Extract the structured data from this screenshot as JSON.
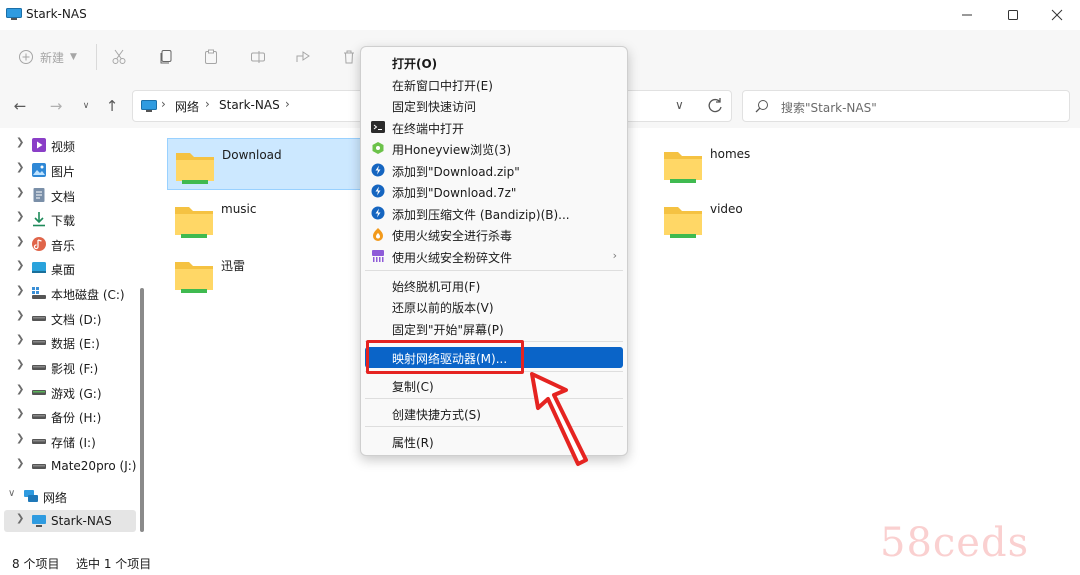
{
  "window": {
    "title": "Stark-NAS"
  },
  "toolbar": {
    "new_label": "新建"
  },
  "address": {
    "crumbs": [
      "网络",
      "Stark-NAS"
    ]
  },
  "search": {
    "placeholder": "搜索\"Stark-NAS\""
  },
  "sidebar": {
    "items": [
      {
        "label": "视频",
        "icon": "video-folder-icon"
      },
      {
        "label": "图片",
        "icon": "pictures-folder-icon"
      },
      {
        "label": "文档",
        "icon": "documents-folder-icon"
      },
      {
        "label": "下载",
        "icon": "downloads-folder-icon"
      },
      {
        "label": "音乐",
        "icon": "music-folder-icon"
      },
      {
        "label": "桌面",
        "icon": "desktop-folder-icon"
      },
      {
        "label": "本地磁盘 (C:)",
        "icon": "windows-drive-icon"
      },
      {
        "label": "文档 (D:)",
        "icon": "drive-icon"
      },
      {
        "label": "数据 (E:)",
        "icon": "drive-icon"
      },
      {
        "label": "影视 (F:)",
        "icon": "drive-icon"
      },
      {
        "label": "游戏 (G:)",
        "icon": "drive-icon"
      },
      {
        "label": "备份 (H:)",
        "icon": "drive-icon"
      },
      {
        "label": "存储 (I:)",
        "icon": "drive-icon"
      },
      {
        "label": "Mate20pro (J:)",
        "icon": "drive-icon"
      },
      {
        "label": "网络",
        "icon": "network-icon"
      },
      {
        "label": "Stark-NAS",
        "icon": "computer-icon"
      }
    ]
  },
  "files": [
    {
      "name": "Download",
      "selected": true
    },
    {
      "name": "homes"
    },
    {
      "name": "music"
    },
    {
      "name": "video"
    },
    {
      "name": "迅雷"
    }
  ],
  "context_menu": {
    "items": [
      {
        "label": "打开(O)",
        "bold": true
      },
      {
        "label": "在新窗口中打开(E)"
      },
      {
        "label": "固定到快速访问"
      },
      {
        "label": "在终端中打开",
        "icon": "terminal-icon"
      },
      {
        "label": "用Honeyview浏览(3)",
        "icon": "honeyview-icon"
      },
      {
        "label": "添加到\"Download.zip\"",
        "icon": "bandizip-icon"
      },
      {
        "label": "添加到\"Download.7z\"",
        "icon": "bandizip-icon"
      },
      {
        "label": "添加到压缩文件 (Bandizip)(B)...",
        "icon": "bandizip-icon"
      },
      {
        "label": "使用火绒安全进行杀毒",
        "icon": "huorong-icon"
      },
      {
        "label": "使用火绒安全粉碎文件",
        "icon": "shredder-icon",
        "submenu": true
      },
      {
        "label": "始终脱机可用(F)"
      },
      {
        "label": "还原以前的版本(V)"
      },
      {
        "label": "固定到\"开始\"屏幕(P)"
      },
      {
        "label": "映射网络驱动器(M)...",
        "highlighted": true
      },
      {
        "label": "复制(C)"
      },
      {
        "label": "创建快捷方式(S)"
      },
      {
        "label": "属性(R)"
      }
    ]
  },
  "status": {
    "item_count": "8 个项目",
    "selected_count": "选中 1 个项目"
  },
  "watermark": {
    "text": "58ceds"
  },
  "colors": {
    "highlight": "#0a64c8",
    "annotation": "#e52421",
    "selection": "#cce8ff"
  }
}
